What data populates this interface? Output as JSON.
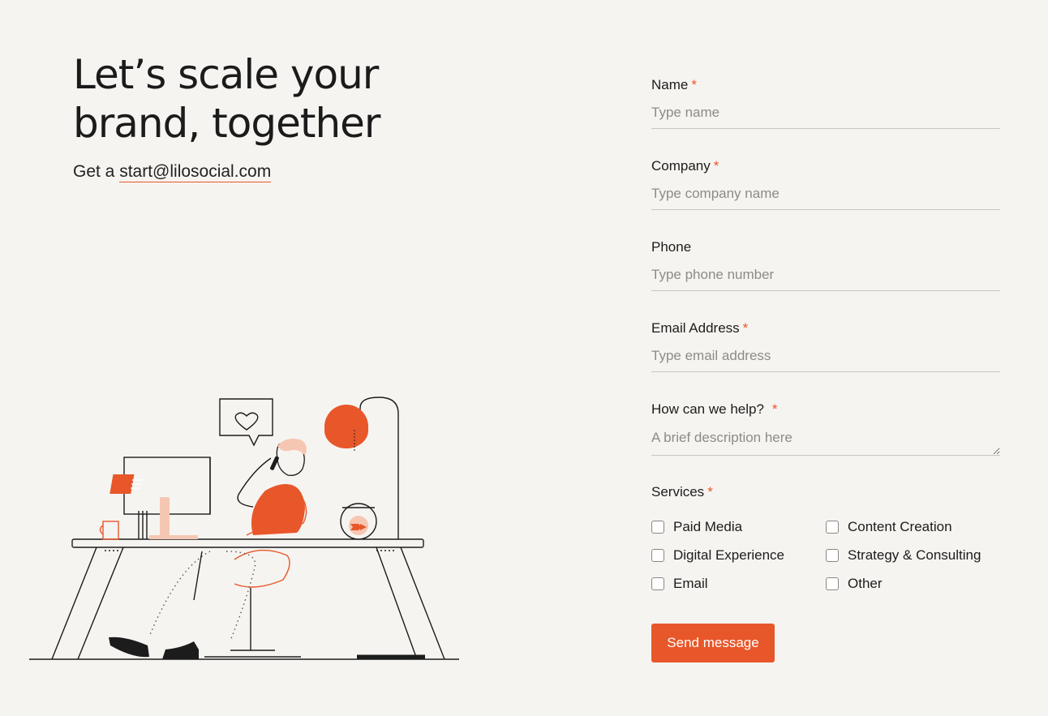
{
  "hero": {
    "headline": "Let’s scale your brand, together",
    "sub_prefix": "Get a ",
    "email": "start@lilosocial.com"
  },
  "form": {
    "required_mark": "*",
    "fields": [
      {
        "label": "Name",
        "placeholder": "Type name",
        "required": true
      },
      {
        "label": "Company",
        "placeholder": "Type company name",
        "required": true
      },
      {
        "label": "Phone",
        "placeholder": "Type phone number",
        "required": false
      },
      {
        "label": "Email Address",
        "placeholder": "Type email address",
        "required": true
      },
      {
        "label": "How can we help?",
        "placeholder": "A brief description here",
        "required": true
      }
    ],
    "services_label": "Services",
    "services": [
      "Paid Media",
      "Content Creation",
      "Digital Experience",
      "Strategy & Consulting",
      "Email",
      "Other"
    ],
    "submit_label": "Send message"
  },
  "colors": {
    "accent": "#e8572a",
    "background": "#f6f4f0",
    "text": "#1c1c1c",
    "placeholder": "#8e8b86"
  },
  "icons": [
    "heart-icon",
    "document-icon",
    "fish-icon"
  ]
}
